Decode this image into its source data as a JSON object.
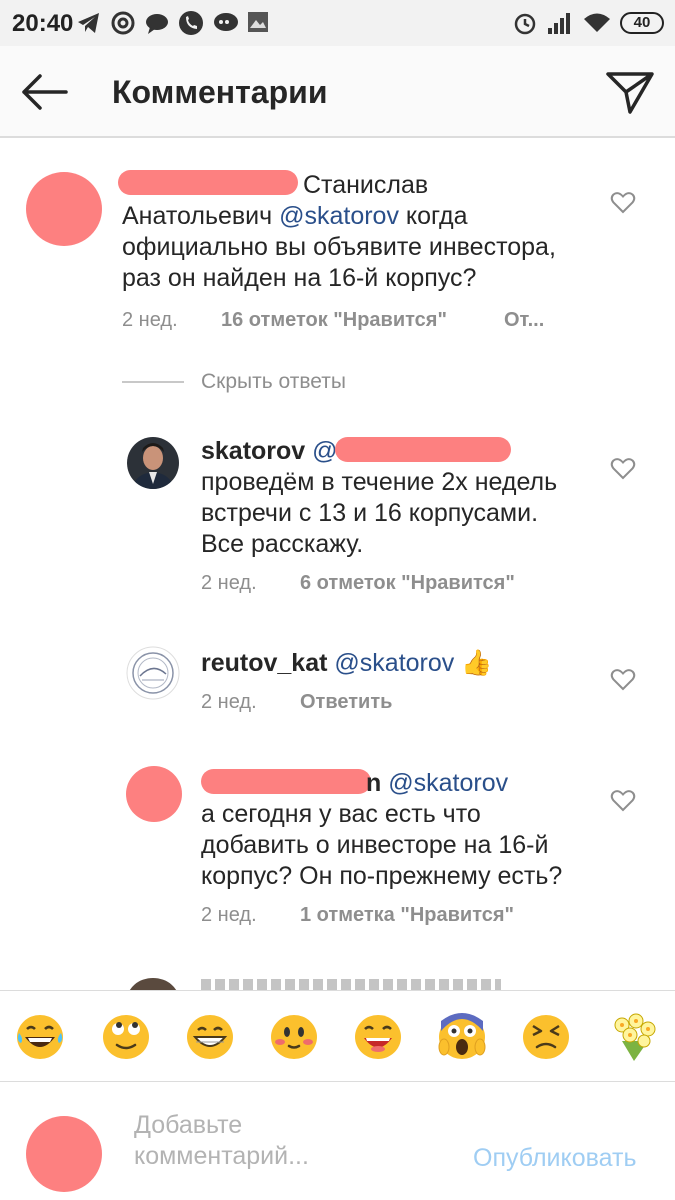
{
  "status_bar": {
    "time": "20:40",
    "battery": "40",
    "left_icons": [
      "telegram-icon",
      "at-icon",
      "chat-bubble-icon",
      "phone-icon",
      "speech-icon",
      "image-icon"
    ],
    "right_icons": [
      "alarm-icon",
      "signal-icon",
      "wifi-icon",
      "battery-icon"
    ]
  },
  "header": {
    "title": "Комментарии",
    "back_icon": "arrow-left-icon",
    "share_icon": "paper-plane-icon"
  },
  "comments": [
    {
      "text_pre": "Станислав",
      "text_line2_pre": "Анатольевич ",
      "mention": "@skatorov",
      "text_line2_post": " когда",
      "line3": "официально вы объявите инвестора,",
      "line4": "раз он найден на 16-й корпус?",
      "time": "2 нед.",
      "likes": "16 отметок \"Нравится\"",
      "reply": "От..."
    },
    {
      "hide_replies": "Скрыть ответы"
    },
    {
      "username": "skatorov",
      "mention_start": "@r",
      "line2": "проведём в течение 2х недель",
      "line3": "встречи с 13 и 16 корпусами.",
      "line4": "Все расскажу.",
      "time": "2 нед.",
      "likes": "6 отметок \"Нравится\""
    },
    {
      "username": "reutov_kat",
      "mention": "@skatorov",
      "emoji": "👍",
      "time": "2 нед.",
      "reply": "Ответить"
    },
    {
      "username_tail": "n",
      "mention": "@skatorov",
      "line2": "а сегодня у вас есть что",
      "line3": "добавить о инвесторе на 16-й",
      "line4": "корпус? Он по-прежнему есть?",
      "time": "2 нед.",
      "likes": "1 отметка \"Нравится\""
    }
  ],
  "emoji_bar": [
    "laughing-tears-emoji",
    "rolling-eyes-emoji",
    "grinning-emoji",
    "blushing-emoji",
    "laughing-emoji",
    "screaming-emoji",
    "persevering-emoji",
    "bouquet-emoji"
  ],
  "composer": {
    "placeholder": "Добавьте комментарий...",
    "placeholder_line1": "Добавьте",
    "placeholder_line2": "комментарий...",
    "publish": "Опубликовать"
  },
  "colors": {
    "mention": "#2a4f8a",
    "redaction": "#fd8080",
    "meta": "#8e8e8e",
    "publish_disabled": "#9fcdf3"
  }
}
